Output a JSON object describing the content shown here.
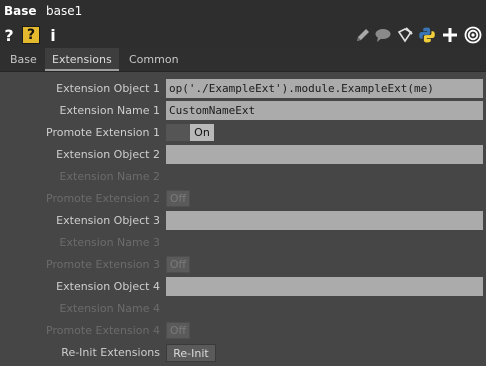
{
  "header": {
    "op_type": "Base",
    "op_name": "base1"
  },
  "toolbar": {
    "help_label": "?",
    "help_python_label": "?",
    "info_label": "i",
    "icons": [
      "pencil-icon",
      "comment-icon",
      "edit-docs-icon",
      "python-icon",
      "add-icon",
      "target-icon"
    ],
    "colors": {
      "help_accent": "#e5b92d",
      "python_blue": "#3a74b3",
      "python_yellow": "#f2cf3a"
    }
  },
  "tabs": [
    {
      "label": "Base",
      "selected": false
    },
    {
      "label": "Extensions",
      "selected": true
    },
    {
      "label": "Common",
      "selected": false
    }
  ],
  "params": {
    "ext_object_1": {
      "label": "Extension Object 1",
      "value": "op('./ExampleExt').module.ExampleExt(me)"
    },
    "ext_name_1": {
      "label": "Extension Name 1",
      "value": "CustomNameExt"
    },
    "promote_1": {
      "label": "Promote Extension 1",
      "state": "On"
    },
    "ext_object_2": {
      "label": "Extension Object 2",
      "value": ""
    },
    "ext_name_2": {
      "label": "Extension Name 2"
    },
    "promote_2": {
      "label": "Promote Extension 2",
      "state": "Off"
    },
    "ext_object_3": {
      "label": "Extension Object 3",
      "value": ""
    },
    "ext_name_3": {
      "label": "Extension Name 3"
    },
    "promote_3": {
      "label": "Promote Extension 3",
      "state": "Off"
    },
    "ext_object_4": {
      "label": "Extension Object 4",
      "value": ""
    },
    "ext_name_4": {
      "label": "Extension Name 4"
    },
    "promote_4": {
      "label": "Promote Extension 4",
      "state": "Off"
    },
    "reinit": {
      "label": "Re-Init Extensions",
      "button": "Re-Init"
    }
  }
}
